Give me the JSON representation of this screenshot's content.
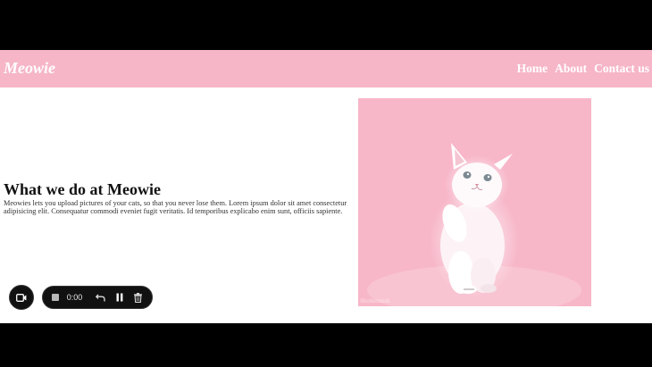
{
  "navbar": {
    "brand": "Meowie",
    "links": [
      "Home",
      "About",
      "Contact us"
    ]
  },
  "hero": {
    "title": "What we do at Meowie",
    "description": "Meowies lets you upload pictures of your cats, so that you never lose them. Lorem ipsum dolor sit amet consectetur adipisicing elit. Consequatur commodi eveniet fugit veritatis. Id temporibus explicabo enim sunt, officiis sapiente.",
    "image_watermark": "Shutterstock"
  },
  "recorder": {
    "timer": "0:00",
    "icons": [
      "video-camera-icon",
      "stop-icon",
      "undo-icon",
      "pause-icon",
      "trash-icon"
    ]
  },
  "colors": {
    "navbar_bg": "#f6b6c8",
    "image_bg": "#f7b7c9",
    "letterbox": "#000000",
    "recorder_bg": "#111111"
  }
}
